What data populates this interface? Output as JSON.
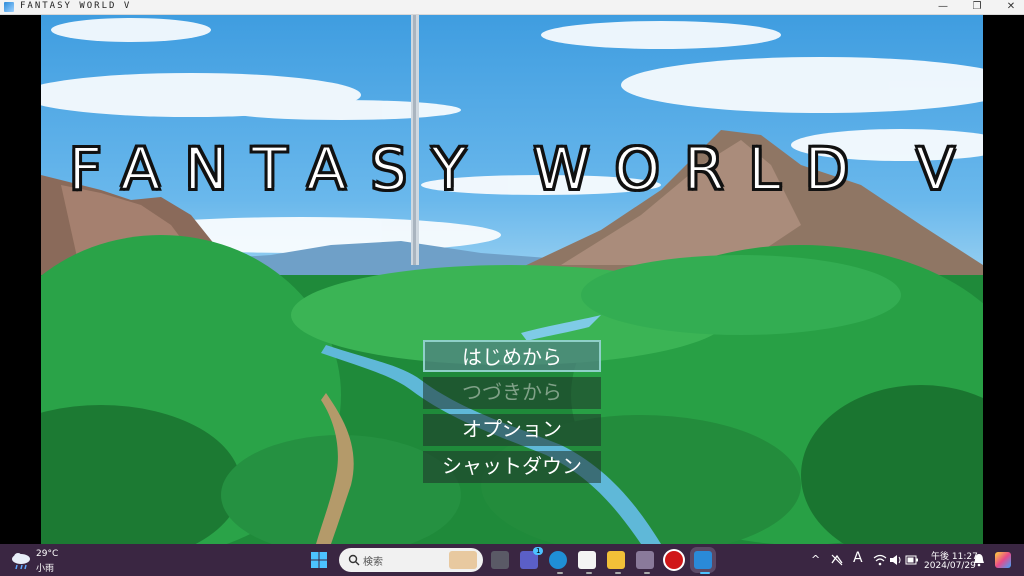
{
  "window": {
    "title": "FANTASY WORLD V",
    "minimize": "—",
    "maximize": "❐",
    "close": "✕"
  },
  "game": {
    "title": "FANTASY WORLD V",
    "menu": [
      {
        "label": "はじめから",
        "state": "selected"
      },
      {
        "label": "つづきから",
        "state": "disabled"
      },
      {
        "label": "オプション",
        "state": "normal"
      },
      {
        "label": "シャットダウン",
        "state": "normal"
      }
    ]
  },
  "taskbar": {
    "weather": {
      "temp": "29°C",
      "desc": "小雨",
      "icon": "cloud-rain-icon"
    },
    "search_placeholder": "検索",
    "apps": [
      "task-view-icon",
      "teams-icon",
      "edge-icon",
      "capcut-icon",
      "file-explorer-icon",
      "game-app-icon",
      "record-icon",
      "active-game-icon"
    ],
    "teams_badge": "1",
    "tray": {
      "chevron": "^",
      "ime": "A",
      "time": "午後 11:27",
      "date": "2024/07/29"
    },
    "colors": {
      "taskbar": "#3a2642",
      "accent": "#4cc2ff"
    }
  }
}
